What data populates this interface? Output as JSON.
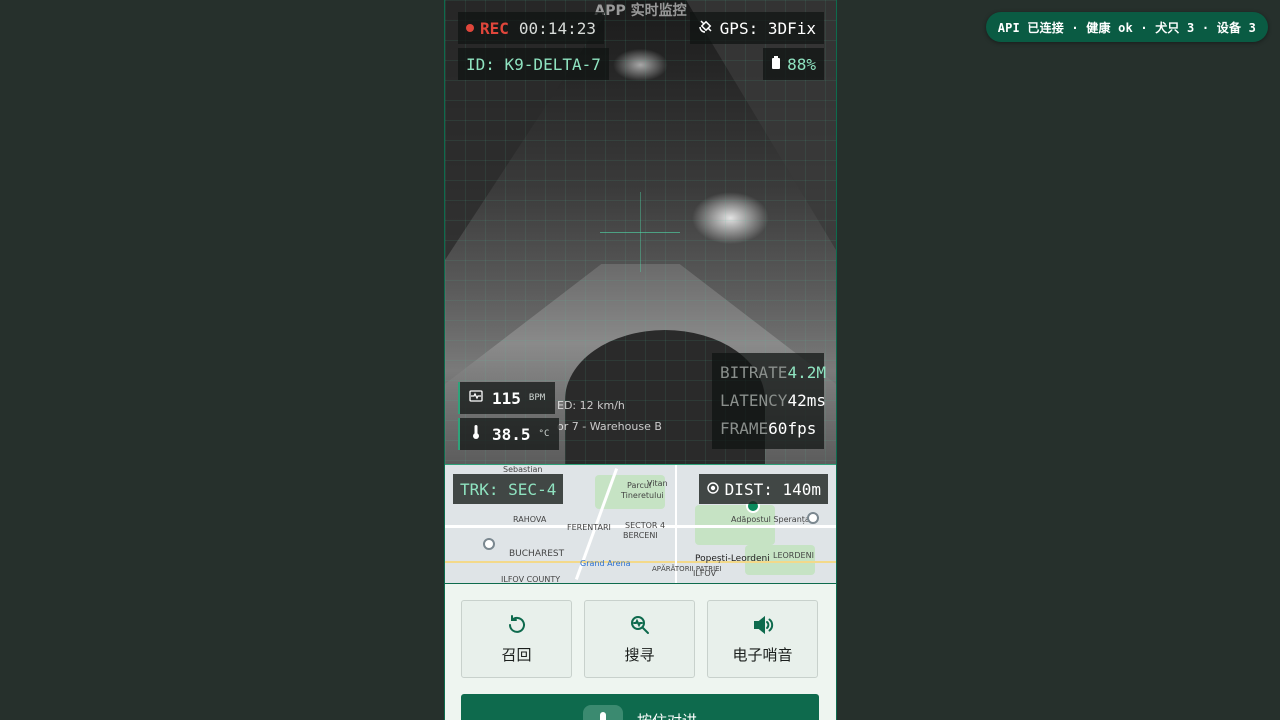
{
  "api_status": "API 已连接 · 健康 ok · 犬只 3 · 设备 3",
  "video": {
    "watermark": "APP 实时监控",
    "rec_label": "REC",
    "rec_time": "00:14:23",
    "gps": "GPS: 3DFix",
    "dog_id": "ID: K9-DELTA-7",
    "battery": "88%",
    "heart_rate": "115",
    "heart_rate_unit": "BPM",
    "temperature": "38.5",
    "temperature_unit": "°C",
    "speed_text": "ED: 12 km/h",
    "location_text": "or 7 - Warehouse B",
    "stats": {
      "bitrate_label": "BITRATE",
      "bitrate_value": "4.2M",
      "latency_label": "LATENCY",
      "latency_value": "42ms",
      "frame_label": "FRAME",
      "frame_value": "60fps"
    }
  },
  "map": {
    "track": "TRK: SEC-4",
    "distance": "DIST: 140m",
    "labels": {
      "sebastian": "Sebastian",
      "parcul": "Parcul",
      "tineretului": "Tineretului",
      "vitan": "Vitan",
      "rahova": "RAHOVA",
      "ferentari": "FERENTARI",
      "sector4": "SECTOR 4",
      "berceni": "BERCENI",
      "adapostul": "Adăpostul Speranța",
      "bucharest": "BUCHAREST",
      "grand_arena": "Grand Arena",
      "popesti": "Popești-Leordeni",
      "leordeni": "LEORDENI",
      "ilfov": "ILFOV COUNTY",
      "apaatorii": "APĂRĂTORII PATRIEI",
      "ilfov2": "ILFOV"
    }
  },
  "controls": {
    "recall": "召回",
    "search": "搜寻",
    "whistle": "电子哨音",
    "primary": "按住对讲"
  },
  "colors": {
    "accent": "#0e6a4d",
    "hud_text": "#8fe3c0",
    "rec_red": "#e0463b",
    "page_bg": "#26302c"
  }
}
